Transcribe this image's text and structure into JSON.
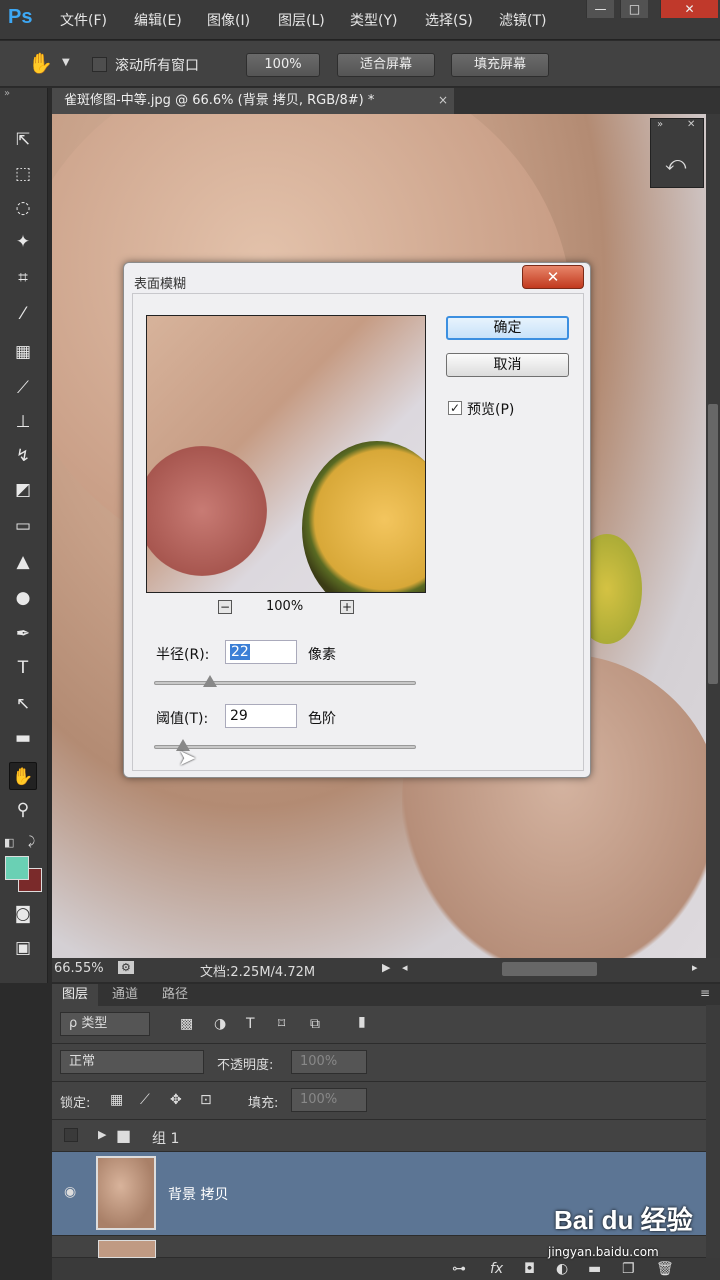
{
  "menubar": {
    "logo": "Ps",
    "items": [
      "文件(F)",
      "编辑(E)",
      "图像(I)",
      "图层(L)",
      "类型(Y)",
      "选择(S)",
      "滤镜(T)"
    ],
    "win_min": "—",
    "win_max": "□",
    "win_close": "✕"
  },
  "options": {
    "scroll_all_label": "滚动所有窗口",
    "zoom_100": "100%",
    "fit_screen": "适合屏幕",
    "fill_screen": "填充屏幕"
  },
  "document": {
    "tab_title": "雀斑修图-中等.jpg @ 66.6% (背景 拷贝, RGB/8#) *",
    "close": "×"
  },
  "status": {
    "zoom": "66.55%",
    "doc_info": "文档:2.25M/4.72M"
  },
  "dialog": {
    "title": "表面模糊",
    "close": "✕",
    "ok": "确定",
    "cancel": "取消",
    "preview_label": "预览(P)",
    "preview_checked": "✓",
    "preview_zoom": "100%",
    "zoom_out": "−",
    "zoom_in": "+",
    "radius_label": "半径(R):",
    "radius_value": "22",
    "radius_unit": "像素",
    "threshold_label": "阈值(T):",
    "threshold_value": "29",
    "threshold_unit": "色阶"
  },
  "layers": {
    "tabs": [
      "图层",
      "通道",
      "路径"
    ],
    "kind_filter": "ρ 类型",
    "blend_mode": "正常",
    "opacity_label": "不透明度:",
    "opacity_value": "100%",
    "lock_label": "锁定:",
    "fill_label": "填充:",
    "fill_value": "100%",
    "group_name": "组 1",
    "layer_name": "背景 拷贝"
  },
  "watermark": {
    "brand": "Bai du 经验",
    "url": "jingyan.baidu.com"
  }
}
